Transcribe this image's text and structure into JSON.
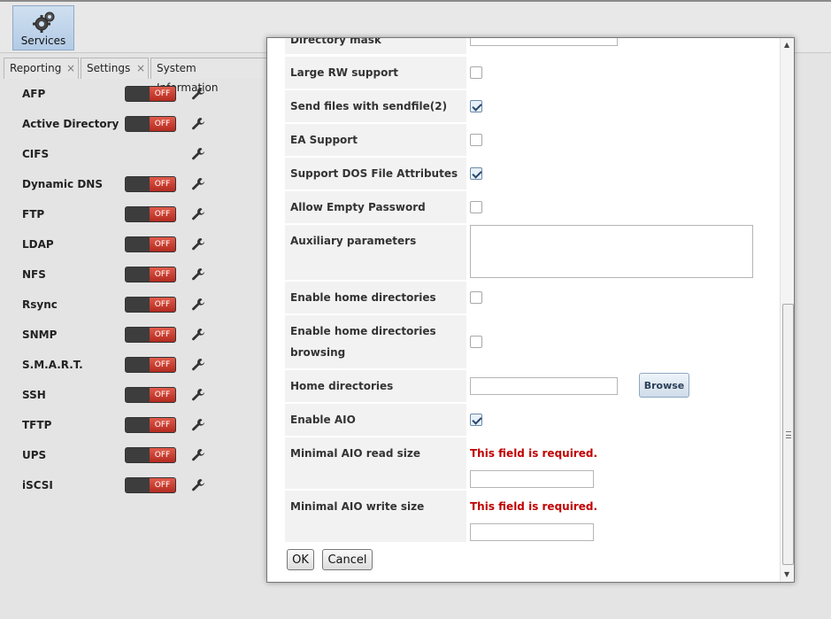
{
  "toolbar": {
    "services_label": "Services"
  },
  "tabs": [
    {
      "label": "Reporting"
    },
    {
      "label": "Settings"
    },
    {
      "label": "System Information"
    }
  ],
  "tab_close_glyph": "×",
  "services": [
    {
      "name": "AFP",
      "toggle": "OFF"
    },
    {
      "name": "Active Directory",
      "toggle": "OFF"
    },
    {
      "name": "CIFS",
      "toggle": ""
    },
    {
      "name": "Dynamic DNS",
      "toggle": "OFF"
    },
    {
      "name": "FTP",
      "toggle": "OFF"
    },
    {
      "name": "LDAP",
      "toggle": "OFF"
    },
    {
      "name": "NFS",
      "toggle": "OFF"
    },
    {
      "name": "Rsync",
      "toggle": "OFF"
    },
    {
      "name": "SNMP",
      "toggle": "OFF"
    },
    {
      "name": "S.M.A.R.T.",
      "toggle": "OFF"
    },
    {
      "name": "SSH",
      "toggle": "OFF"
    },
    {
      "name": "TFTP",
      "toggle": "OFF"
    },
    {
      "name": "UPS",
      "toggle": "OFF"
    },
    {
      "name": "iSCSI",
      "toggle": "OFF"
    }
  ],
  "dialog": {
    "fields": {
      "directory_mask": {
        "label": "Directory mask",
        "value": ""
      },
      "large_rw": {
        "label": "Large RW support",
        "checked": false
      },
      "sendfile": {
        "label": "Send files with sendfile(2)",
        "checked": true
      },
      "ea_support": {
        "label": "EA Support",
        "checked": false
      },
      "dos_attrs": {
        "label": "Support DOS File Attributes",
        "checked": true
      },
      "empty_password": {
        "label": "Allow Empty Password",
        "checked": false
      },
      "aux_params": {
        "label": "Auxiliary parameters",
        "value": ""
      },
      "home_dirs": {
        "label": "Enable home directories",
        "checked": false
      },
      "home_browse": {
        "label": "Enable home directories browsing",
        "checked": false
      },
      "home_path": {
        "label": "Home directories",
        "value": "",
        "browse_label": "Browse"
      },
      "aio": {
        "label": "Enable AIO",
        "checked": true
      },
      "aio_read": {
        "label": "Minimal AIO read size",
        "error": "This field is required.",
        "value": ""
      },
      "aio_write": {
        "label": "Minimal AIO write size",
        "error": "This field is required.",
        "value": ""
      }
    },
    "ok_label": "OK",
    "cancel_label": "Cancel"
  }
}
